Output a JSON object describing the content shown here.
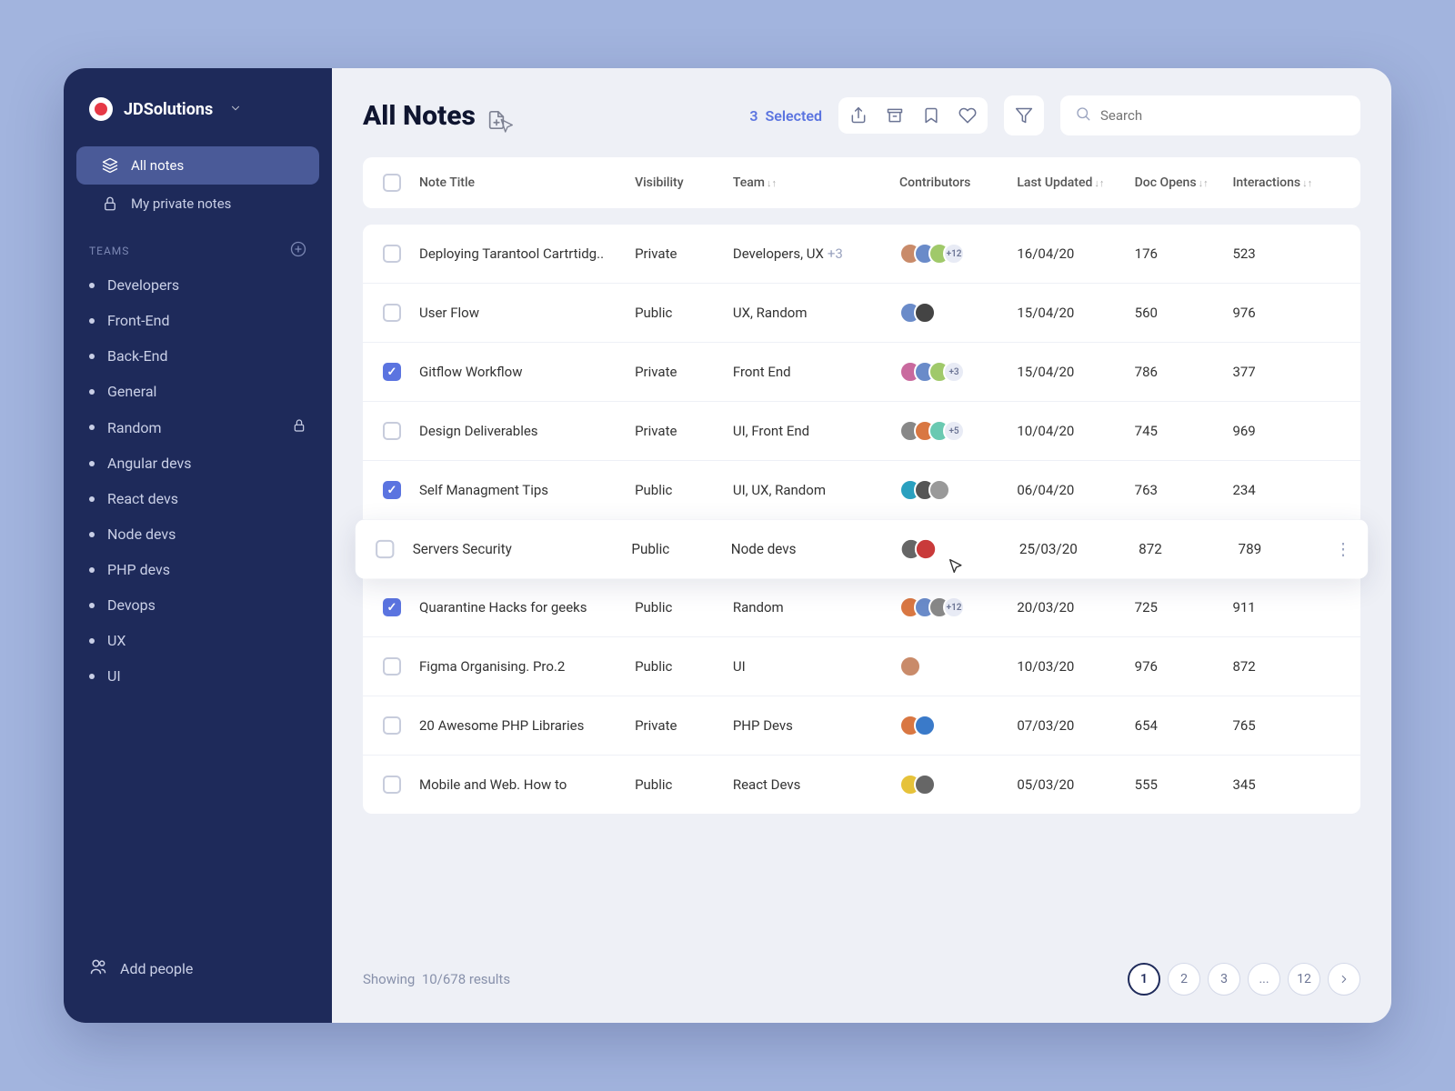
{
  "brand": {
    "name": "JDSolutions"
  },
  "nav": {
    "all_notes": "All notes",
    "private_notes": "My private notes"
  },
  "teams_header": "TEAMS",
  "teams": [
    {
      "label": "Developers",
      "locked": false
    },
    {
      "label": "Front-End",
      "locked": false
    },
    {
      "label": "Back-End",
      "locked": false
    },
    {
      "label": "General",
      "locked": false
    },
    {
      "label": "Random",
      "locked": true
    },
    {
      "label": "Angular devs",
      "locked": false
    },
    {
      "label": "React devs",
      "locked": false
    },
    {
      "label": "Node devs",
      "locked": false
    },
    {
      "label": "PHP devs",
      "locked": false
    },
    {
      "label": "Devops",
      "locked": false
    },
    {
      "label": "UX",
      "locked": false
    },
    {
      "label": "UI",
      "locked": false
    }
  ],
  "add_people": "Add people",
  "page_title": "All Notes",
  "selected_count": "3",
  "selected_label": "Selected",
  "search_placeholder": "Search",
  "columns": {
    "title": "Note Title",
    "visibility": "Visibility",
    "team": "Team",
    "contributors": "Contributors",
    "updated": "Last Updated",
    "opens": "Doc Opens",
    "interactions": "Interactions"
  },
  "rows": [
    {
      "checked": false,
      "title": "Deploying Tarantool Cartrtidg..",
      "visibility": "Private",
      "team": "Developers, UX",
      "team_extra": "+3",
      "avatars": [
        "#c98b6a",
        "#6a8bc9",
        "#a0c96a"
      ],
      "more": "+12",
      "updated": "16/04/20",
      "opens": "176",
      "interactions": "523"
    },
    {
      "checked": false,
      "title": "User Flow",
      "visibility": "Public",
      "team": "UX, Random",
      "team_extra": "",
      "avatars": [
        "#6a8bc9",
        "#444"
      ],
      "more": "",
      "updated": "15/04/20",
      "opens": "560",
      "interactions": "976"
    },
    {
      "checked": true,
      "title": "Gitflow Workflow",
      "visibility": "Private",
      "team": "Front End",
      "team_extra": "",
      "avatars": [
        "#c96a9e",
        "#6a8bc9",
        "#a0c96a"
      ],
      "more": "+3",
      "updated": "15/04/20",
      "opens": "786",
      "interactions": "377"
    },
    {
      "checked": false,
      "title": "Design Deliverables",
      "visibility": "Private",
      "team": "UI, Front End",
      "team_extra": "",
      "avatars": [
        "#888",
        "#d97742",
        "#6ac9b1"
      ],
      "more": "+5",
      "updated": "10/04/20",
      "opens": "745",
      "interactions": "969"
    },
    {
      "checked": true,
      "title": "Self Managment Tips",
      "visibility": "Public",
      "team": "UI, UX, Random",
      "team_extra": "",
      "avatars": [
        "#2aa0bf",
        "#555",
        "#999"
      ],
      "more": "",
      "updated": "06/04/20",
      "opens": "763",
      "interactions": "234"
    },
    {
      "checked": false,
      "title": "Servers Security",
      "visibility": "Public",
      "team": "Node devs",
      "team_extra": "",
      "avatars": [
        "#666",
        "#c93a3a"
      ],
      "more": "",
      "updated": "25/03/20",
      "opens": "872",
      "interactions": "789",
      "hover": true
    },
    {
      "checked": true,
      "title": "Quarantine Hacks for geeks",
      "visibility": "Public",
      "team": "Random",
      "team_extra": "",
      "avatars": [
        "#d97742",
        "#6a8bc9",
        "#888"
      ],
      "more": "+12",
      "updated": "20/03/20",
      "opens": "725",
      "interactions": "911"
    },
    {
      "checked": false,
      "title": "Figma Organising. Pro.2",
      "visibility": "Public",
      "team": "UI",
      "team_extra": "",
      "avatars": [
        "#c98b6a"
      ],
      "more": "",
      "updated": "10/03/20",
      "opens": "976",
      "interactions": "872"
    },
    {
      "checked": false,
      "title": "20 Awesome PHP Libraries",
      "visibility": "Private",
      "team": "PHP Devs",
      "team_extra": "",
      "avatars": [
        "#d97742",
        "#3a7ac9"
      ],
      "more": "",
      "updated": "07/03/20",
      "opens": "654",
      "interactions": "765"
    },
    {
      "checked": false,
      "title": "Mobile and Web. How to",
      "visibility": "Public",
      "team": "React Devs",
      "team_extra": "",
      "avatars": [
        "#e6c23a",
        "#666"
      ],
      "more": "",
      "updated": "05/03/20",
      "opens": "555",
      "interactions": "345"
    }
  ],
  "footer": {
    "showing": "Showing",
    "results": "10/678 results"
  },
  "pages": [
    "1",
    "2",
    "3",
    "...",
    "12"
  ]
}
